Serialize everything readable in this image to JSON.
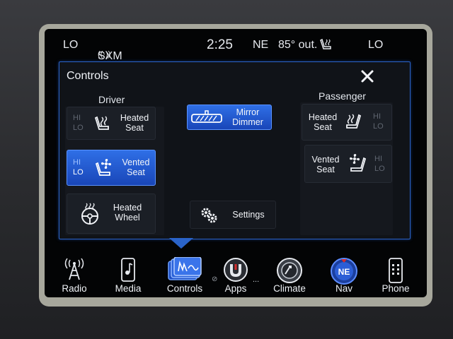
{
  "status_bar": {
    "temp_left": "LO",
    "radio_station": "SXM 1",
    "time": "2:25",
    "compass": "NE",
    "outside_temp": "85° out.",
    "temp_right": "LO"
  },
  "panel": {
    "title": "Controls",
    "driver_label": "Driver",
    "passenger_label": "Passenger",
    "driver_heated_seat": {
      "hi": "HI",
      "lo": "LO",
      "line1": "Heated",
      "line2": "Seat"
    },
    "driver_vented_seat": {
      "hi": "HI",
      "lo": "LO",
      "line1": "Vented",
      "line2": "Seat"
    },
    "heated_wheel": {
      "line1": "Heated",
      "line2": "Wheel"
    },
    "mirror_dimmer": {
      "line1": "Mirror",
      "line2": "Dimmer"
    },
    "settings": "Settings",
    "passenger_heated_seat": {
      "hi": "HI",
      "lo": "LO",
      "line1": "Heated",
      "line2": "Seat"
    },
    "passenger_vented_seat": {
      "hi": "HI",
      "lo": "LO",
      "line1": "Vented",
      "line2": "Seat"
    }
  },
  "nav": {
    "radio": "Radio",
    "media": "Media",
    "controls": "Controls",
    "apps": "Apps",
    "apps_more": "...",
    "climate": "Climate",
    "nav": "Nav",
    "nav_badge": "NE",
    "phone": "Phone"
  },
  "colors": {
    "accent_blue": "#2f6fe6",
    "panel_border": "#2a63c9",
    "nav_red": "#d62b2b"
  }
}
